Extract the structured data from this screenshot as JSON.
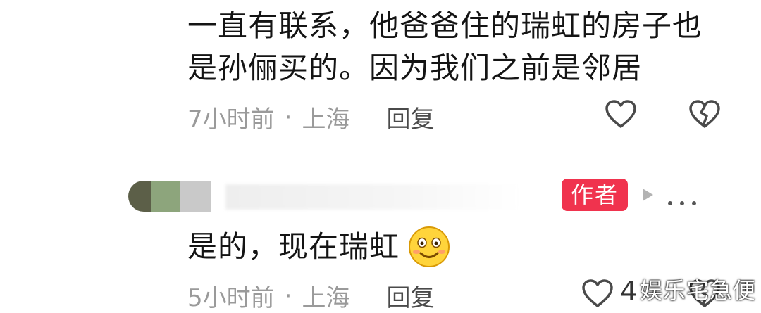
{
  "comment1": {
    "line1": "一直有联系，他爸爸住的瑞虹的房子也",
    "line2": "是孙俪买的。因为我们之前是邻居",
    "time": "7小时前",
    "separator": "·",
    "location": "上海",
    "reply_label": "回复"
  },
  "comment2": {
    "author_badge": "作者",
    "text": "是的，现在瑞虹",
    "emoji": "smiling-face-emoji",
    "time": "5小时前",
    "separator": "·",
    "location": "上海",
    "reply_label": "回复",
    "like_count": "4"
  },
  "watermark": "娱乐宅急便",
  "colors": {
    "badge": "#f0334e",
    "meta_text": "#9a9a9a",
    "icon": "#4a4a4a"
  }
}
